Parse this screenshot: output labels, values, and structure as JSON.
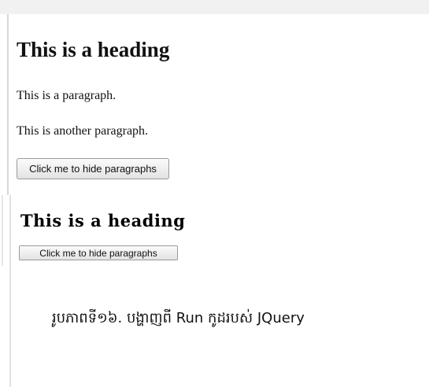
{
  "demo1": {
    "heading": "This is a heading",
    "paragraph1": "This is a paragraph.",
    "paragraph2": "This is another paragraph.",
    "button_label": "Click me to hide paragraphs"
  },
  "demo2": {
    "heading": "This is a heading",
    "button_label": "Click me to hide paragraphs"
  },
  "caption": "រូបភាពទី១៦. បង្ហាញពី Run កូដរបស់ JQuery"
}
